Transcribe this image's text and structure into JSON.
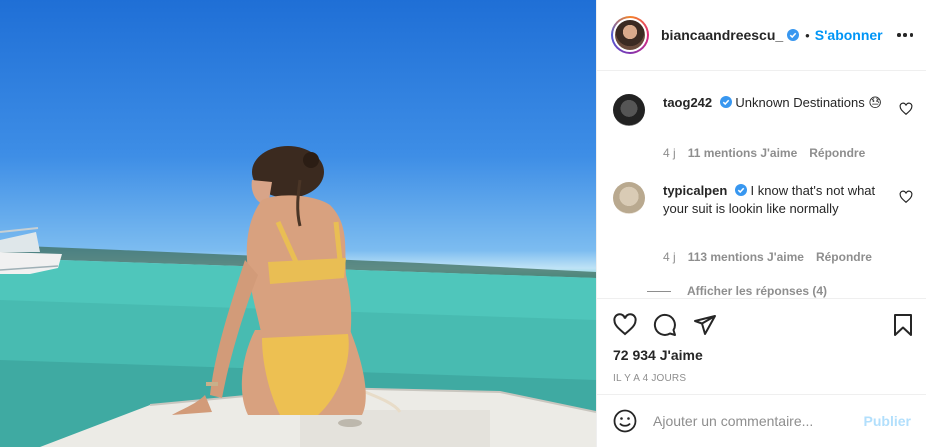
{
  "post": {
    "username": "biancaandreescu_",
    "separator": "•",
    "follow_label": "S'abonner"
  },
  "comments": [
    {
      "username": "taog242",
      "text": "Unknown Destinations 😓",
      "age": "4 j",
      "likes": "11 mentions J'aime",
      "reply_label": "Répondre"
    },
    {
      "username": "typicalpen",
      "text": "I know that's not what your suit is lookin like normally",
      "age": "4 j",
      "likes": "113 mentions J'aime",
      "reply_label": "Répondre"
    }
  ],
  "view_replies": "Afficher les réponses (4)",
  "likes_count": "72 934 J'aime",
  "timestamp": "IL Y A 4 JOURS",
  "add_comment": {
    "placeholder": "Ajouter un commentaire...",
    "post_label": "Publier"
  },
  "colors": {
    "accent": "#0095f6",
    "verified": "#3897f0",
    "post_disabled": "#b2dffc"
  }
}
